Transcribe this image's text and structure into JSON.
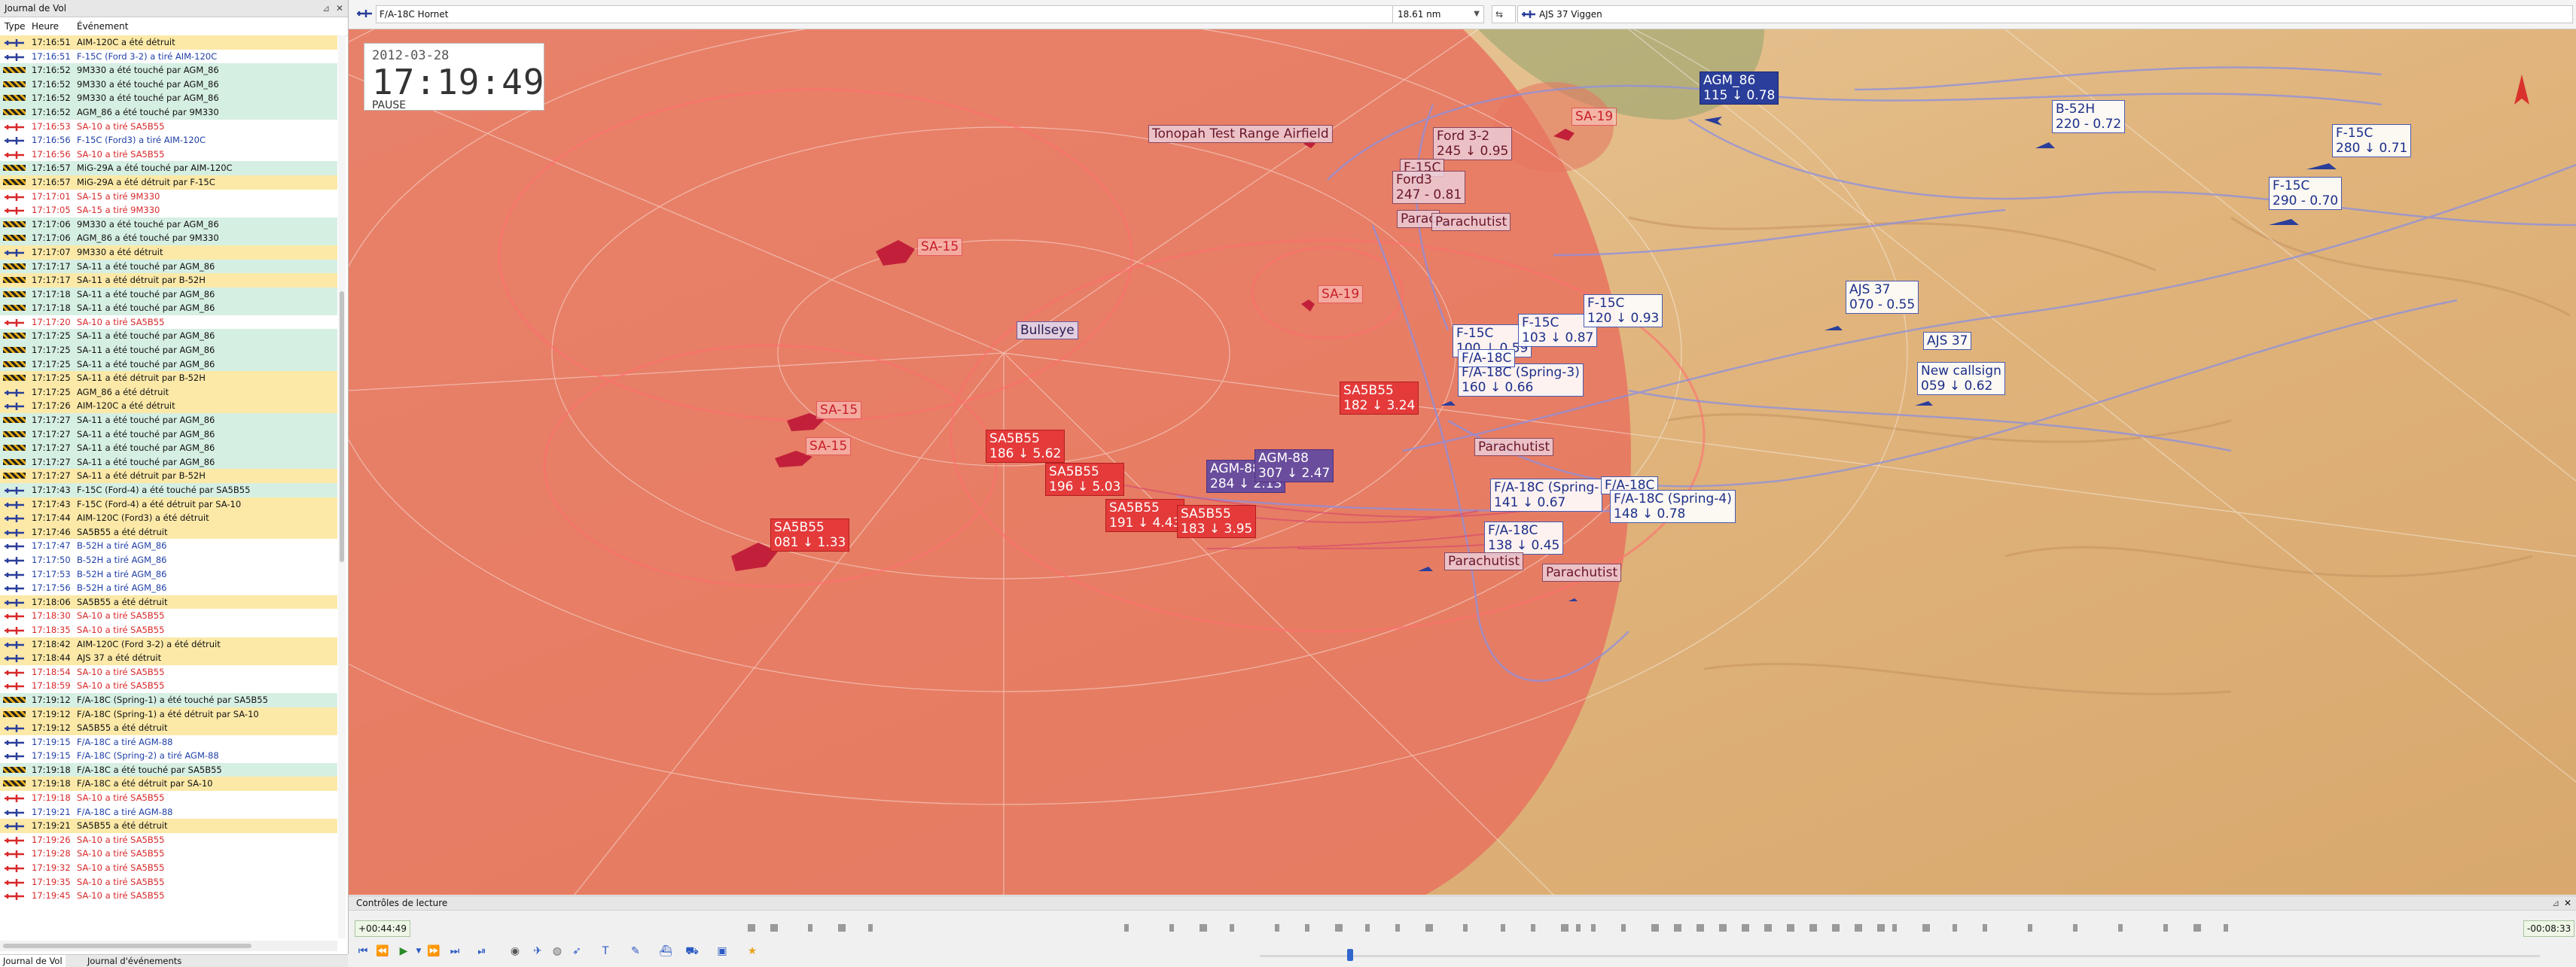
{
  "log_panel": {
    "title": "Journal de Vol",
    "columns": {
      "type": "Type",
      "time": "Heure",
      "event": "Événement"
    },
    "rows": [
      {
        "t": "17:16:51",
        "e": "AIM-120C a été détruit",
        "c": "black",
        "hl": "yellow",
        "icon": "jet"
      },
      {
        "t": "17:16:51",
        "e": "F-15C (Ford 3-2) a tiré AIM-120C",
        "c": "blue",
        "hl": "",
        "icon": "jet"
      },
      {
        "t": "17:16:52",
        "e": "9M330 a été touché par AGM_86",
        "c": "black",
        "hl": "green",
        "icon": "hazard"
      },
      {
        "t": "17:16:52",
        "e": "9M330 a été touché par AGM_86",
        "c": "black",
        "hl": "green",
        "icon": "hazard"
      },
      {
        "t": "17:16:52",
        "e": "9M330 a été touché par AGM_86",
        "c": "black",
        "hl": "green",
        "icon": "hazard"
      },
      {
        "t": "17:16:52",
        "e": "AGM_86 a été touché par 9M330",
        "c": "black",
        "hl": "green",
        "icon": "hazard"
      },
      {
        "t": "17:16:53",
        "e": "SA-10 a tiré SA5B55",
        "c": "red",
        "hl": "",
        "icon": "jet"
      },
      {
        "t": "17:16:56",
        "e": "F-15C (Ford3) a tiré AIM-120C",
        "c": "blue",
        "hl": "",
        "icon": "jet"
      },
      {
        "t": "17:16:56",
        "e": "SA-10 a tiré SA5B55",
        "c": "red",
        "hl": "",
        "icon": "jet"
      },
      {
        "t": "17:16:57",
        "e": "MiG-29A a été touché par AIM-120C",
        "c": "black",
        "hl": "green",
        "icon": "hazard"
      },
      {
        "t": "17:16:57",
        "e": "MiG-29A a été détruit par F-15C",
        "c": "black",
        "hl": "yellow",
        "icon": "hazard"
      },
      {
        "t": "17:17:01",
        "e": "SA-15 a tiré 9M330",
        "c": "red",
        "hl": "",
        "icon": "jet"
      },
      {
        "t": "17:17:05",
        "e": "SA-15 a tiré 9M330",
        "c": "red",
        "hl": "",
        "icon": "jet"
      },
      {
        "t": "17:17:06",
        "e": "9M330 a été touché par AGM_86",
        "c": "black",
        "hl": "green",
        "icon": "hazard"
      },
      {
        "t": "17:17:06",
        "e": "AGM_86 a été touché par 9M330",
        "c": "black",
        "hl": "green",
        "icon": "hazard"
      },
      {
        "t": "17:17:07",
        "e": "9M330 a été détruit",
        "c": "black",
        "hl": "yellow",
        "icon": "jet"
      },
      {
        "t": "17:17:17",
        "e": "SA-11 a été touché par AGM_86",
        "c": "black",
        "hl": "green",
        "icon": "hazard"
      },
      {
        "t": "17:17:17",
        "e": "SA-11 a été détruit par B-52H",
        "c": "black",
        "hl": "yellow",
        "icon": "hazard"
      },
      {
        "t": "17:17:18",
        "e": "SA-11 a été touché par AGM_86",
        "c": "black",
        "hl": "green",
        "icon": "hazard"
      },
      {
        "t": "17:17:18",
        "e": "SA-11 a été touché par AGM_86",
        "c": "black",
        "hl": "green",
        "icon": "hazard"
      },
      {
        "t": "17:17:20",
        "e": "SA-10 a tiré SA5B55",
        "c": "red",
        "hl": "",
        "icon": "jet"
      },
      {
        "t": "17:17:25",
        "e": "SA-11 a été touché par AGM_86",
        "c": "black",
        "hl": "green",
        "icon": "hazard"
      },
      {
        "t": "17:17:25",
        "e": "SA-11 a été touché par AGM_86",
        "c": "black",
        "hl": "green",
        "icon": "hazard"
      },
      {
        "t": "17:17:25",
        "e": "SA-11 a été touché par AGM_86",
        "c": "black",
        "hl": "green",
        "icon": "hazard"
      },
      {
        "t": "17:17:25",
        "e": "SA-11 a été détruit par B-52H",
        "c": "black",
        "hl": "yellow",
        "icon": "hazard"
      },
      {
        "t": "17:17:25",
        "e": "AGM_86 a été détruit",
        "c": "black",
        "hl": "yellow",
        "icon": "jet"
      },
      {
        "t": "17:17:26",
        "e": "AIM-120C a été détruit",
        "c": "black",
        "hl": "yellow",
        "icon": "jet"
      },
      {
        "t": "17:17:27",
        "e": "SA-11 a été touché par AGM_86",
        "c": "black",
        "hl": "green",
        "icon": "hazard"
      },
      {
        "t": "17:17:27",
        "e": "SA-11 a été touché par AGM_86",
        "c": "black",
        "hl": "green",
        "icon": "hazard"
      },
      {
        "t": "17:17:27",
        "e": "SA-11 a été touché par AGM_86",
        "c": "black",
        "hl": "green",
        "icon": "hazard"
      },
      {
        "t": "17:17:27",
        "e": "SA-11 a été touché par AGM_86",
        "c": "black",
        "hl": "green",
        "icon": "hazard"
      },
      {
        "t": "17:17:27",
        "e": "SA-11 a été détruit par B-52H",
        "c": "black",
        "hl": "yellow",
        "icon": "hazard"
      },
      {
        "t": "17:17:43",
        "e": "F-15C (Ford-4) a été touché par SA5B55",
        "c": "black",
        "hl": "green",
        "icon": "jet"
      },
      {
        "t": "17:17:43",
        "e": "F-15C (Ford-4) a été détruit par SA-10",
        "c": "black",
        "hl": "yellow",
        "icon": "jet"
      },
      {
        "t": "17:17:44",
        "e": "AIM-120C (Ford3) a été détruit",
        "c": "black",
        "hl": "yellow",
        "icon": "jet"
      },
      {
        "t": "17:17:46",
        "e": "SA5B55 a été détruit",
        "c": "black",
        "hl": "yellow",
        "icon": "jet"
      },
      {
        "t": "17:17:47",
        "e": "B-52H a tiré AGM_86",
        "c": "blue",
        "hl": "",
        "icon": "jet"
      },
      {
        "t": "17:17:50",
        "e": "B-52H a tiré AGM_86",
        "c": "blue",
        "hl": "",
        "icon": "jet"
      },
      {
        "t": "17:17:53",
        "e": "B-52H a tiré AGM_86",
        "c": "blue",
        "hl": "",
        "icon": "jet"
      },
      {
        "t": "17:17:56",
        "e": "B-52H a tiré AGM_86",
        "c": "blue",
        "hl": "",
        "icon": "jet"
      },
      {
        "t": "17:18:06",
        "e": "SA5B55 a été détruit",
        "c": "black",
        "hl": "yellow",
        "icon": "jet"
      },
      {
        "t": "17:18:30",
        "e": "SA-10 a tiré SA5B55",
        "c": "red",
        "hl": "",
        "icon": "jet"
      },
      {
        "t": "17:18:35",
        "e": "SA-10 a tiré SA5B55",
        "c": "red",
        "hl": "",
        "icon": "jet"
      },
      {
        "t": "17:18:42",
        "e": "AIM-120C (Ford 3-2) a été détruit",
        "c": "black",
        "hl": "yellow",
        "icon": "jet"
      },
      {
        "t": "17:18:44",
        "e": "AJS 37 a été détruit",
        "c": "black",
        "hl": "yellow",
        "icon": "jet"
      },
      {
        "t": "17:18:54",
        "e": "SA-10 a tiré SA5B55",
        "c": "red",
        "hl": "",
        "icon": "jet"
      },
      {
        "t": "17:18:59",
        "e": "SA-10 a tiré SA5B55",
        "c": "red",
        "hl": "",
        "icon": "jet"
      },
      {
        "t": "17:19:12",
        "e": "F/A-18C (Spring-1) a été touché par SA5B55",
        "c": "black",
        "hl": "green",
        "icon": "hazard"
      },
      {
        "t": "17:19:12",
        "e": "F/A-18C (Spring-1) a été détruit par SA-10",
        "c": "black",
        "hl": "yellow",
        "icon": "hazard"
      },
      {
        "t": "17:19:12",
        "e": "SA5B55 a été détruit",
        "c": "black",
        "hl": "yellow",
        "icon": "jet"
      },
      {
        "t": "17:19:15",
        "e": "F/A-18C a tiré AGM-88",
        "c": "blue",
        "hl": "",
        "icon": "jet"
      },
      {
        "t": "17:19:15",
        "e": "F/A-18C (Spring-2) a tiré AGM-88",
        "c": "blue",
        "hl": "",
        "icon": "jet"
      },
      {
        "t": "17:19:18",
        "e": "F/A-18C a été touché par SA5B55",
        "c": "black",
        "hl": "green",
        "icon": "hazard"
      },
      {
        "t": "17:19:18",
        "e": "F/A-18C a été détruit par SA-10",
        "c": "black",
        "hl": "yellow",
        "icon": "hazard"
      },
      {
        "t": "17:19:18",
        "e": "SA-10 a tiré SA5B55",
        "c": "red",
        "hl": "",
        "icon": "jet"
      },
      {
        "t": "17:19:21",
        "e": "F/A-18C a tiré AGM-88",
        "c": "blue",
        "hl": "",
        "icon": "jet"
      },
      {
        "t": "17:19:21",
        "e": "SA5B55 a été détruit",
        "c": "black",
        "hl": "yellow",
        "icon": "jet"
      },
      {
        "t": "17:19:26",
        "e": "SA-10 a tiré SA5B55",
        "c": "red",
        "hl": "",
        "icon": "jet"
      },
      {
        "t": "17:19:28",
        "e": "SA-10 a tiré SA5B55",
        "c": "red",
        "hl": "",
        "icon": "jet"
      },
      {
        "t": "17:19:32",
        "e": "SA-10 a tiré SA5B55",
        "c": "red",
        "hl": "",
        "icon": "jet"
      },
      {
        "t": "17:19:35",
        "e": "SA-10 a tiré SA5B55",
        "c": "red",
        "hl": "",
        "icon": "jet"
      },
      {
        "t": "17:19:45",
        "e": "SA-10 a tiré SA5B55",
        "c": "red",
        "hl": "",
        "icon": "jet"
      }
    ],
    "tabs": [
      "Journal de Vol",
      "Journal d'événements"
    ]
  },
  "toolbar": {
    "aircraft_left": "F/A-18C Hornet",
    "range": "18.61 nm",
    "aircraft_right": "AJS 37 Viggen"
  },
  "clock": {
    "date": "2012-03-28",
    "time": "17:19:49",
    "state": "PAUSE"
  },
  "map_labels": {
    "airfield": "Tonopah Test Range Airfield",
    "bullseye": "Bullseye",
    "sa15_a": "SA-15",
    "sa15_b": "SA-15",
    "sa15_c": "SA-15",
    "sa19_a": "SA-19",
    "sa19_b": "SA-19",
    "ford32": "Ford 3-2\n245 ↓ 0.95",
    "f15c_top": "F-15C",
    "ford3": "Ford3\n247 - 0.81",
    "parac1": "Parac",
    "parachutist1": "Parachutist",
    "f15c_mid1": "F-15C\n100 ↓ 0.59",
    "f15c_mid2": "F-15C\n103 ↓ 0.87",
    "f15c_mid3": "F-15C\n120 ↓ 0.93",
    "fa18_spring3": "F/A-18C (Spring-3)\n160 ↓ 0.66",
    "fa18_a": "F/A-18C",
    "parachutist2": "Parachutist",
    "fa18_spring_b": "F/A-18C (Spring-\n141 ↓ 0.67",
    "fa18_b": "F/A-18C",
    "fa18_spring4": "F/A-18C (Spring-4)\n148 ↓ 0.78",
    "fa18_c": "F/A-18C\n138 ↓ 0.45",
    "parachutist3": "Parachutist",
    "parachutist4": "Parachutist",
    "sa5_1": "SA5B55\n182 ↓ 3.24",
    "sa5_2": "SA5B55\n186 ↓ 5.62",
    "sa5_3": "SA5B55\n196 ↓ 5.03",
    "sa5_4": "SA5B55\n191 ↓ 4.43",
    "sa5_5": "SA5B55\n183 ↓ 3.95",
    "sa5_6": "SA5B55\n081 ↓ 1.33",
    "agm88_a": "AGM-88\n284 ↓ 2.13",
    "agm88_b": "AGM-88\n307 ↓ 2.47",
    "agm86": "AGM_86\n115 ↓ 0.78",
    "b52h": "B-52H\n220 - 0.72",
    "f15c_r1": "F-15C\n280 ↓ 0.71",
    "f15c_r2": "F-15C\n290 - 0.70",
    "ajs37_a": "AJS 37\n070 - 0.55",
    "ajs37_b": "AJS 37",
    "new_callsign": "New callsign\n059 ↓ 0.62"
  },
  "playback": {
    "title": "Contrôles de lecture",
    "elapsed": "+00:44:49",
    "remaining": "-00:08:33"
  },
  "colors": {
    "red_zone": "#e8735f",
    "terrain": "#e2b882",
    "blue_unit": "#2a3e9a",
    "red_unit": "#c81e2a"
  }
}
